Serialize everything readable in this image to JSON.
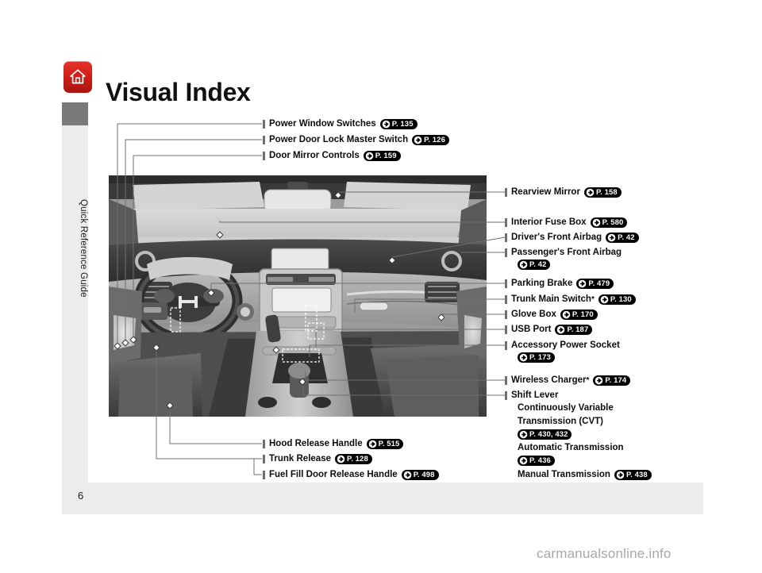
{
  "document": {
    "title": "Visual Index",
    "page_number": "6",
    "sidebar_tab": "Quick Reference Guide",
    "watermark": "carmanualsonline.info",
    "home_icon": "home-icon"
  },
  "callouts_top_left": [
    {
      "label": "Power Window Switches",
      "page_ref": "P. 135",
      "star": false
    },
    {
      "label": "Power Door Lock Master Switch",
      "page_ref": "P. 126",
      "star": false
    },
    {
      "label": "Door Mirror Controls",
      "page_ref": "P. 159",
      "star": false
    }
  ],
  "callouts_right": [
    {
      "label": "Rearview Mirror",
      "page_ref": "P. 158",
      "star": false
    },
    {
      "label": "Interior Fuse Box",
      "page_ref": "P. 580",
      "star": false
    },
    {
      "label": "Driver's Front Airbag",
      "page_ref": "P. 42",
      "star": false
    },
    {
      "label": "Passenger's Front Airbag",
      "page_ref": "P. 42",
      "star": false,
      "wrap": true
    },
    {
      "label": "Parking Brake",
      "page_ref": "P. 479",
      "star": false
    },
    {
      "label": "Trunk Main Switch",
      "page_ref": "P. 130",
      "star": true
    },
    {
      "label": "Glove Box",
      "page_ref": "P. 170",
      "star": false
    },
    {
      "label": "USB Port",
      "page_ref": "P. 187",
      "star": false
    },
    {
      "label": "Accessory Power Socket",
      "page_ref": "P. 173",
      "star": false,
      "wrap": true
    },
    {
      "label": "Wireless Charger",
      "page_ref": "P. 174",
      "star": true
    },
    {
      "label": "Shift Lever",
      "page_ref": "",
      "star": false
    }
  ],
  "shift_lever_variants": [
    {
      "line1": "Continuously Variable",
      "line2": "Transmission (CVT)",
      "page_ref": "P. 430, 432"
    },
    {
      "line1": "Automatic Transmission",
      "line2": "",
      "page_ref": "P. 436"
    },
    {
      "line1": "Manual Transmission",
      "line2": "",
      "page_ref": "P. 438",
      "inline": true
    }
  ],
  "callouts_bottom": [
    {
      "label": "Hood Release Handle",
      "page_ref": "P. 515",
      "star": false
    },
    {
      "label": "Trunk Release",
      "page_ref": "P. 128",
      "star": false
    },
    {
      "label": "Fuel Fill Door Release Handle",
      "page_ref": "P. 498",
      "star": false
    }
  ],
  "photo": {
    "alt": "Honda Accord front interior cabin, grayscale cutaway view",
    "icons": [
      "steering-wheel",
      "honda-emblem",
      "center-display",
      "shift-lever",
      "glove-box",
      "rearview-mirror"
    ]
  },
  "colors": {
    "accent_red": "#cf1f18",
    "sidebar_gray": "#ececec",
    "sidebar_cap_gray": "#7a7a7a",
    "badge_black": "#000000",
    "leader_gray": "#6f6f6f",
    "watermark_gray": "#a8a8a8"
  }
}
